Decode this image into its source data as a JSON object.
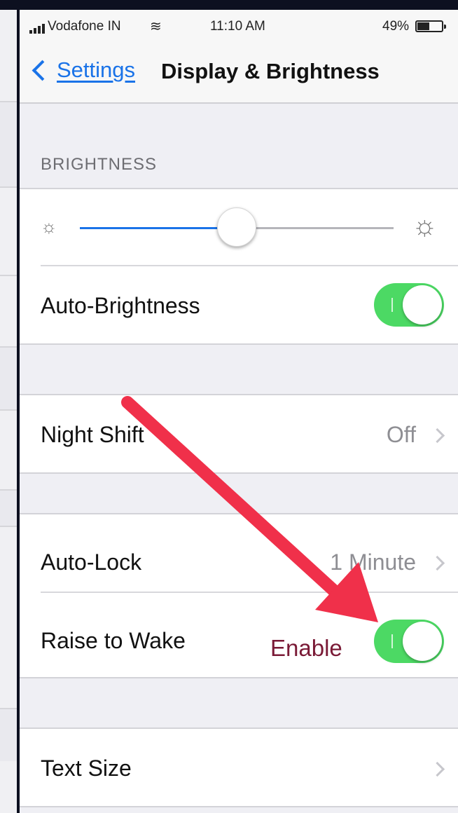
{
  "status_bar": {
    "carrier": "Vodafone IN",
    "time": "11:10 AM",
    "battery_percent": "49%",
    "battery_level": 0.49,
    "wifi_icon": "wifi-icon"
  },
  "nav": {
    "back_label": "Settings",
    "title": "Display & Brightness"
  },
  "sections": {
    "brightness_header": "BRIGHTNESS"
  },
  "brightness": {
    "level": 0.5
  },
  "rows": {
    "auto_brightness": {
      "label": "Auto-Brightness",
      "on": true
    },
    "night_shift": {
      "label": "Night Shift",
      "value": "Off"
    },
    "auto_lock": {
      "label": "Auto-Lock",
      "value": "1 Minute"
    },
    "raise_to_wake": {
      "label": "Raise to Wake",
      "on": true
    },
    "text_size": {
      "label": "Text Size"
    }
  },
  "annotation": {
    "label": "Enable",
    "arrow_color": "#f0304a",
    "label_color": "#7a1a36"
  },
  "colors": {
    "toggle_on": "#4cd964",
    "link_blue": "#1a73e8"
  }
}
